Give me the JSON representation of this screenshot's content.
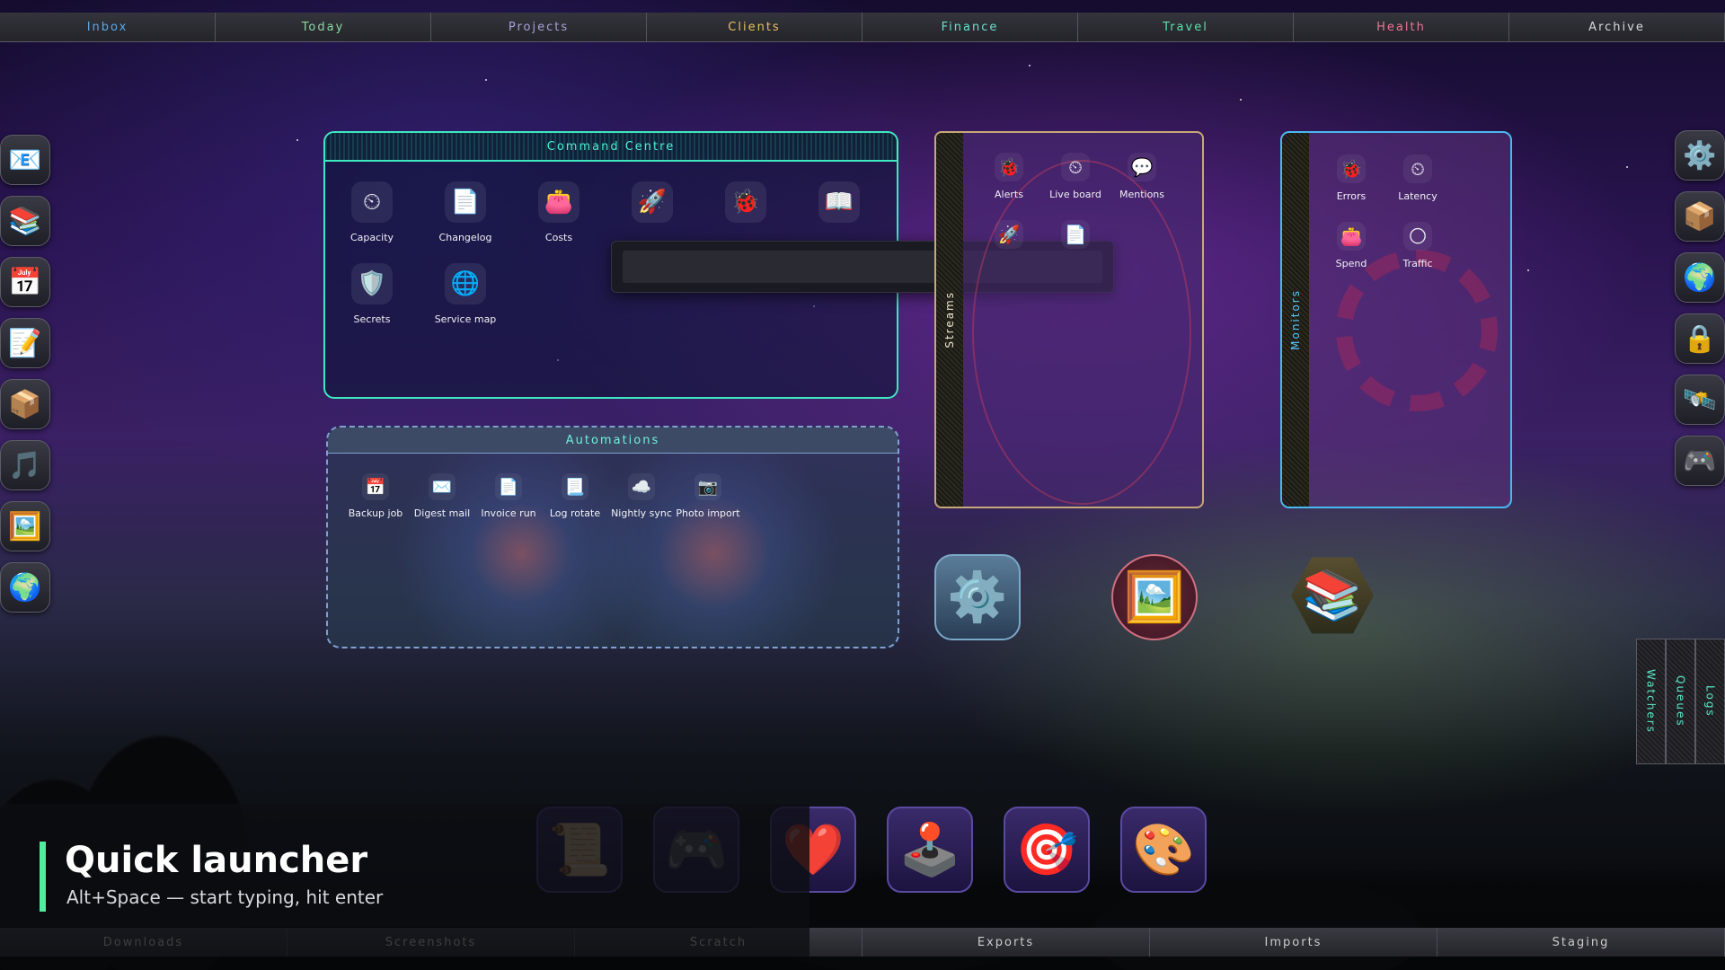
{
  "topbar": [
    {
      "label": "Inbox",
      "color": "#5aa8e8"
    },
    {
      "label": "Today",
      "color": "#8ad8a0"
    },
    {
      "label": "Projects",
      "color": "#a8a0d8"
    },
    {
      "label": "Clients",
      "color": "#e8c060"
    },
    {
      "label": "Finance",
      "color": "#6ae0c8"
    },
    {
      "label": "Travel",
      "color": "#5ae0a8"
    },
    {
      "label": "Health",
      "color": "#e87890"
    },
    {
      "label": "Archive",
      "color": "#d8d8e0"
    }
  ],
  "dock_left": [
    {
      "name": "mail-icon",
      "glyph": "📧"
    },
    {
      "name": "books-icon",
      "glyph": "📚"
    },
    {
      "name": "calendar-icon",
      "glyph": "📅"
    },
    {
      "name": "notes-icon",
      "glyph": "📝"
    },
    {
      "name": "package-icon",
      "glyph": "📦"
    },
    {
      "name": "music-icon",
      "glyph": "🎵"
    },
    {
      "name": "photos-icon",
      "glyph": "🖼️"
    },
    {
      "name": "globe-icon",
      "glyph": "🌍"
    }
  ],
  "dock_right": [
    {
      "name": "settings-icon",
      "glyph": "⚙️"
    },
    {
      "name": "package-icon",
      "glyph": "📦"
    },
    {
      "name": "globe-icon",
      "glyph": "🌍"
    },
    {
      "name": "lock-icon",
      "glyph": "🔒"
    },
    {
      "name": "satellite-icon",
      "glyph": "🛰️"
    },
    {
      "name": "gamepad-icon",
      "glyph": "🎮"
    }
  ],
  "command_centre": {
    "title": "Command Centre",
    "items": [
      {
        "label": "Capacity",
        "glyph": "⏲"
      },
      {
        "label": "Changelog",
        "glyph": "📄"
      },
      {
        "label": "Costs",
        "glyph": "👛"
      },
      {
        "label": "",
        "glyph": "🚀"
      },
      {
        "label": "",
        "glyph": "🐞"
      },
      {
        "label": "",
        "glyph": "📖"
      },
      {
        "label": "Secrets",
        "glyph": "🛡️"
      },
      {
        "label": "Service map",
        "glyph": "🌐"
      }
    ]
  },
  "automations": {
    "title": "Automations",
    "items": [
      {
        "label": "Backup job",
        "glyph": "📅"
      },
      {
        "label": "Digest mail",
        "glyph": "✉️"
      },
      {
        "label": "Invoice run",
        "glyph": "📄"
      },
      {
        "label": "Log rotate",
        "glyph": "📃"
      },
      {
        "label": "Nightly sync",
        "glyph": "☁️"
      },
      {
        "label": "Photo import",
        "glyph": "📷"
      }
    ]
  },
  "streams": {
    "title": "Streams",
    "items": [
      {
        "label": "Alerts",
        "glyph": "🐞"
      },
      {
        "label": "Live board",
        "glyph": "⏲"
      },
      {
        "label": "Mentions",
        "glyph": "💬"
      },
      {
        "label": "",
        "glyph": "🚀"
      },
      {
        "label": "",
        "glyph": "📄"
      }
    ]
  },
  "monitors": {
    "title": "Monitors",
    "items": [
      {
        "label": "Errors",
        "glyph": "🐞"
      },
      {
        "label": "Latency",
        "glyph": "⏲"
      },
      {
        "label": "Spend",
        "glyph": "👛"
      },
      {
        "label": "Traffic",
        "glyph": "🌕"
      }
    ]
  },
  "big_icons": [
    {
      "name": "settings-icon",
      "glyph": "⚙️"
    },
    {
      "name": "photos-icon",
      "glyph": "🖼️"
    },
    {
      "name": "books-icon",
      "glyph": "📚"
    }
  ],
  "game_dock": [
    {
      "name": "scroll-icon",
      "glyph": "📜"
    },
    {
      "name": "gamepad-icon",
      "glyph": "🎮"
    },
    {
      "name": "heart-icon",
      "glyph": "❤️"
    },
    {
      "name": "joystick-icon",
      "glyph": "🕹️"
    },
    {
      "name": "target-icon",
      "glyph": "🎯"
    },
    {
      "name": "palette-icon",
      "glyph": "🎨"
    }
  ],
  "side_tabs": [
    "Watchers",
    "Queues",
    "Logs"
  ],
  "bottombar": [
    "Downloads",
    "Screenshots",
    "Scratch",
    "Exports",
    "Imports",
    "Staging"
  ],
  "launcher": {
    "title": "Quick launcher",
    "hint": "Alt+Space — start typing, hit enter"
  }
}
